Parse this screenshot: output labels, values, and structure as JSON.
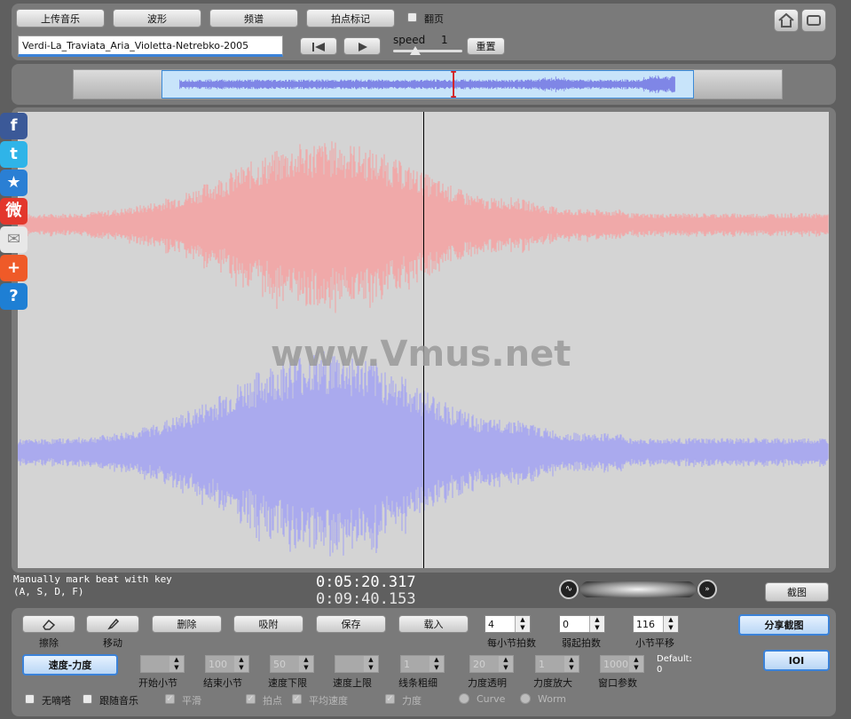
{
  "toolbar": {
    "upload_label": "上传音乐",
    "waveform_label": "波形",
    "spectrum_label": "频谱",
    "beat_mark_label": "拍点标记",
    "page_flip_label": "翻页",
    "filename": "Verdi-La_Traviata_Aria_Violetta-Netrebko-2005",
    "speed_label": "speed",
    "speed_value": "1",
    "reset_label": "重置"
  },
  "overview": {
    "playhead_fraction": 0.47,
    "view_start_fraction": 0.14,
    "view_end_fraction": 0.87
  },
  "waveform": {
    "watermark": "www.Vmus.net",
    "playhead_fraction": 0.5,
    "channel_colors": [
      "#f0a9a9",
      "#aaaaee"
    ]
  },
  "status": {
    "hint_line1": "Manually mark beat with key",
    "hint_line2": "(A, S, D, F)",
    "current_time": "0:05:20.317",
    "total_time": "0:09:40.153",
    "screenshot_label": "截图"
  },
  "controls": {
    "erase_label": "擦除",
    "move_label": "移动",
    "delete_label": "删除",
    "snap_label": "吸附",
    "save_label": "保存",
    "load_label": "载入",
    "beats_per_bar": {
      "value": "4",
      "label": "每小节拍数"
    },
    "pickup_beats": {
      "value": "0",
      "label": "弱起拍数"
    },
    "bar_offset": {
      "value": "116",
      "label": "小节平移"
    },
    "share_label": "分享截图",
    "ioi_label": "IOI",
    "tempo_dynamics_label": "速度-力度",
    "params": [
      {
        "label": "开始小节",
        "value": ""
      },
      {
        "label": "结束小节",
        "value": "100"
      },
      {
        "label": "速度下限",
        "value": "50"
      },
      {
        "label": "速度上限",
        "value": ""
      },
      {
        "label": "线条粗细",
        "value": "1"
      },
      {
        "label": "力度透明",
        "value": "20"
      },
      {
        "label": "力度放大",
        "value": "1"
      },
      {
        "label": "窗口参数",
        "value": "1000"
      }
    ],
    "default_label": "Default:",
    "default_value": "0",
    "checks": [
      {
        "label": "无嘀嗒"
      },
      {
        "label": "跟随音乐"
      },
      {
        "label": "平滑"
      },
      {
        "label": "拍点"
      },
      {
        "label": "平均速度"
      },
      {
        "label": "力度"
      }
    ],
    "radios": [
      {
        "label": "Curve"
      },
      {
        "label": "Worm"
      }
    ]
  },
  "social": [
    {
      "name": "facebook",
      "glyph": "f",
      "color": "#3b5998"
    },
    {
      "name": "twitter",
      "glyph": "t",
      "color": "#2fb4e8"
    },
    {
      "name": "favorite",
      "glyph": "★",
      "color": "#2a7fd4"
    },
    {
      "name": "weibo",
      "glyph": "微",
      "color": "#e3372c"
    },
    {
      "name": "email",
      "glyph": "✉",
      "color": "#e8e8e8"
    },
    {
      "name": "add",
      "glyph": "+",
      "color": "#ef5a28"
    },
    {
      "name": "help",
      "glyph": "?",
      "color": "#1e7fd4"
    }
  ]
}
